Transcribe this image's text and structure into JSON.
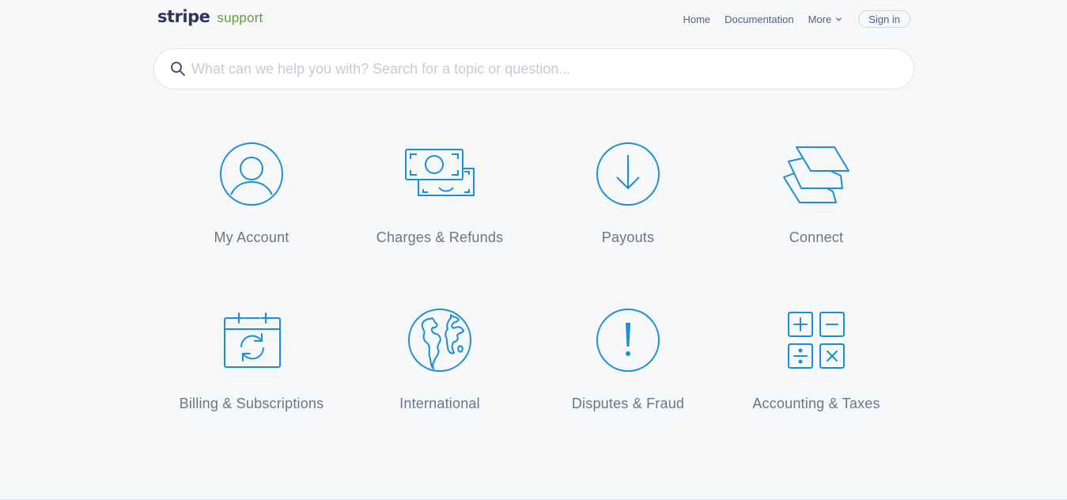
{
  "header": {
    "brand": "stripe",
    "brand_sub": "support",
    "nav": {
      "home": "Home",
      "documentation": "Documentation",
      "more": "More",
      "sign_in": "Sign in"
    }
  },
  "search": {
    "placeholder": "What can we help you with? Search for a topic or question...",
    "value": ""
  },
  "categories": [
    {
      "label": "My Account",
      "icon": "user-circle-icon"
    },
    {
      "label": "Charges & Refunds",
      "icon": "cash-bills-icon"
    },
    {
      "label": "Payouts",
      "icon": "arrow-down-circle-icon"
    },
    {
      "label": "Connect",
      "icon": "stacked-layers-icon"
    },
    {
      "label": "Billing & Subscriptions",
      "icon": "calendar-refresh-icon"
    },
    {
      "label": "International",
      "icon": "globe-icon"
    },
    {
      "label": "Disputes & Fraud",
      "icon": "exclamation-circle-icon"
    },
    {
      "label": "Accounting & Taxes",
      "icon": "calculator-icon"
    }
  ],
  "colors": {
    "icon_blue": "#1a8fd8",
    "brand_navy": "#32325d",
    "brand_green": "#5f9e3a",
    "label_gray": "#6b7684",
    "background": "#f6f8fa"
  }
}
